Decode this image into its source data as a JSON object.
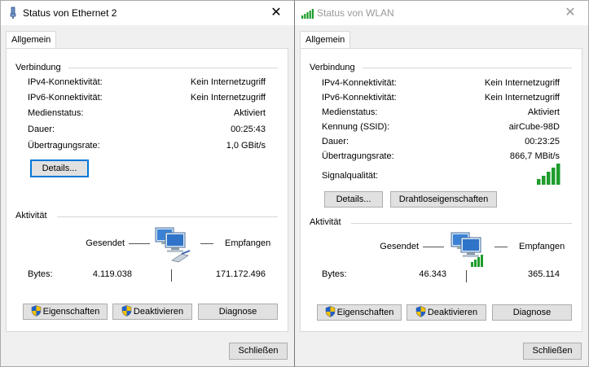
{
  "eth": {
    "title": "Status von Ethernet 2",
    "close": "✕",
    "tab": "Allgemein",
    "group_connection": "Verbindung",
    "rows": [
      {
        "label": "IPv4-Konnektivität:",
        "value": "Kein Internetzugriff"
      },
      {
        "label": "IPv6-Konnektivität:",
        "value": "Kein Internetzugriff"
      },
      {
        "label": "Medienstatus:",
        "value": "Aktiviert"
      },
      {
        "label": "Dauer:",
        "value": "00:25:43"
      },
      {
        "label": "Übertragungsrate:",
        "value": "1,0 GBit/s"
      }
    ],
    "details_btn": "Details...",
    "group_activity": "Aktivität",
    "sent": "Gesendet",
    "received": "Empfangen",
    "bytes_label": "Bytes:",
    "bytes_sent": "4.119.038",
    "bytes_received": "171.172.496",
    "btn_properties": "Eigenschaften",
    "btn_deactivate": "Deaktivieren",
    "btn_diagnose": "Diagnose",
    "btn_close": "Schließen"
  },
  "wlan": {
    "title": "Status von WLAN",
    "close": "✕",
    "tab": "Allgemein",
    "group_connection": "Verbindung",
    "rows": [
      {
        "label": "IPv4-Konnektivität:",
        "value": "Kein Internetzugriff"
      },
      {
        "label": "IPv6-Konnektivität:",
        "value": "Kein Internetzugriff"
      },
      {
        "label": "Medienstatus:",
        "value": "Aktiviert"
      },
      {
        "label": "Kennung (SSID):",
        "value": "airCube-98D"
      },
      {
        "label": "Dauer:",
        "value": "00:23:25"
      },
      {
        "label": "Übertragungsrate:",
        "value": "866,7 MBit/s"
      }
    ],
    "signal_label": "Signalqualität:",
    "details_btn": "Details...",
    "wireless_btn": "Drahtloseigenschaften",
    "group_activity": "Aktivität",
    "sent": "Gesendet",
    "received": "Empfangen",
    "bytes_label": "Bytes:",
    "bytes_sent": "46.343",
    "bytes_received": "365.114",
    "btn_properties": "Eigenschaften",
    "btn_deactivate": "Deaktivieren",
    "btn_diagnose": "Diagnose",
    "btn_close": "Schließen"
  },
  "colors": {
    "signal": "#1e9c2c",
    "focus": "#0078d7"
  },
  "icons": [
    "ethernet-icon",
    "wifi-signal-icon",
    "close-icon",
    "network-computers-icon",
    "uac-shield-icon",
    "signal-bars-icon"
  ]
}
